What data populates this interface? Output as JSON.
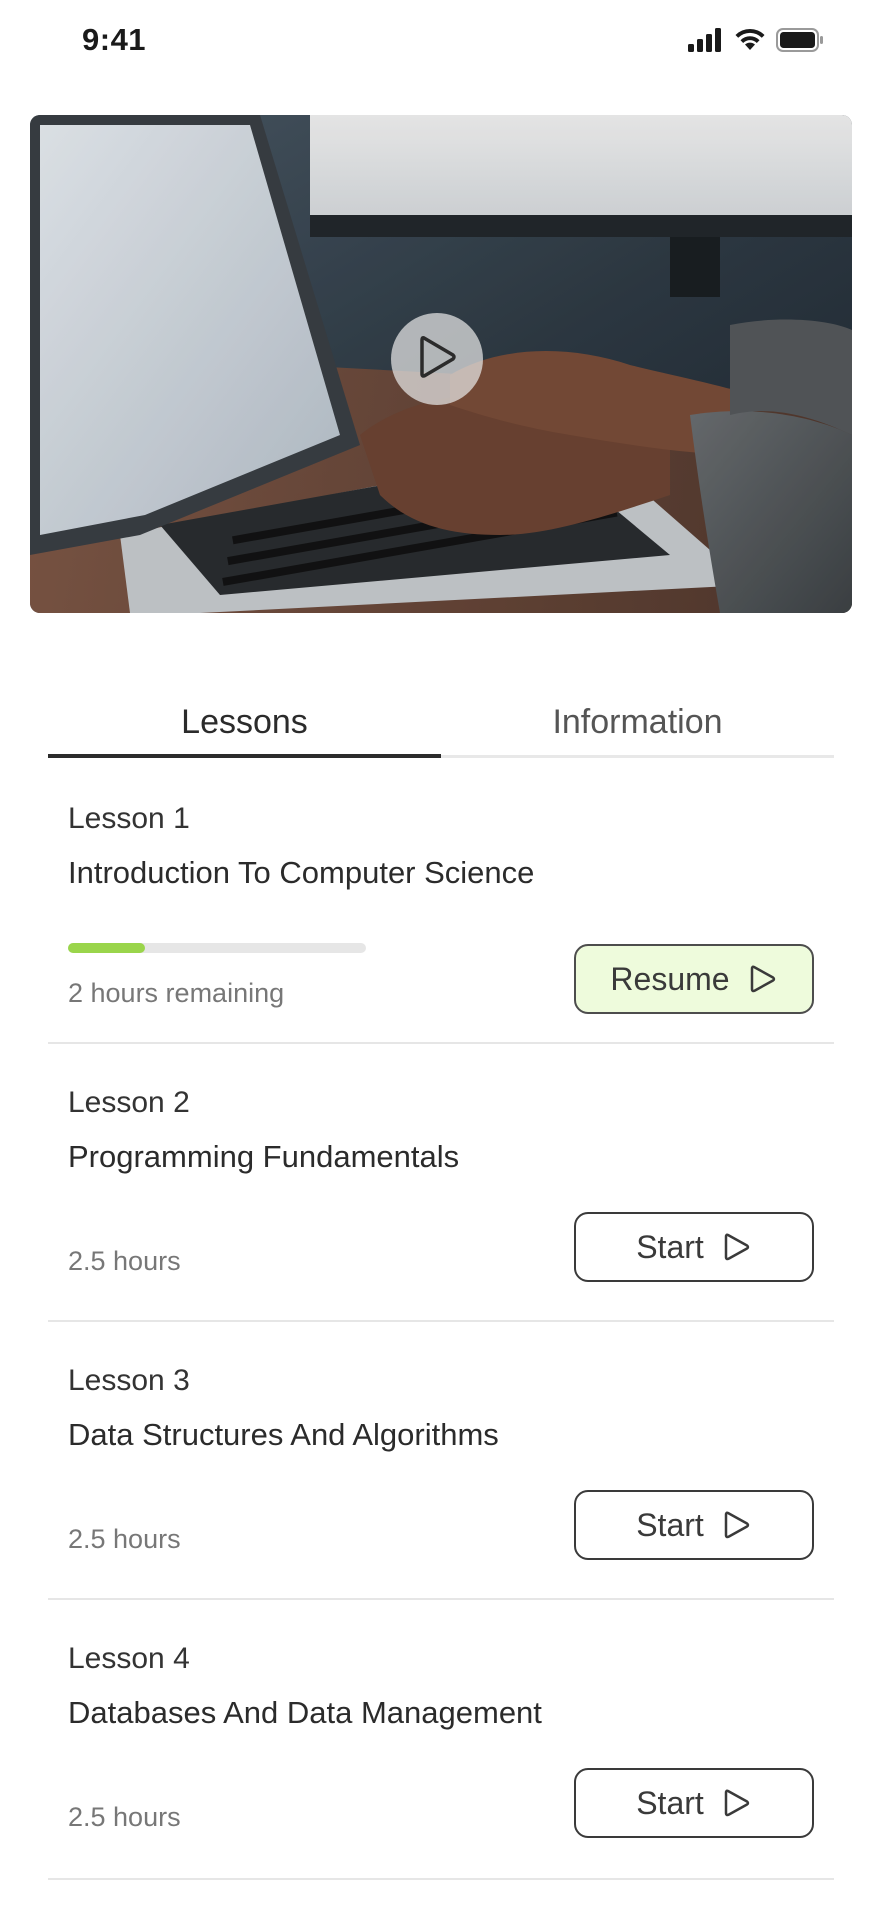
{
  "status_bar": {
    "time": "9:41",
    "icons": [
      "cellular-signal-icon",
      "wifi-icon",
      "battery-icon"
    ]
  },
  "video": {
    "play_icon": "play-icon"
  },
  "tabs": [
    {
      "label": "Lessons",
      "active": true
    },
    {
      "label": "Information",
      "active": false
    }
  ],
  "lessons": [
    {
      "number": "Lesson 1",
      "title": "Introduction To Computer Science",
      "meta": "2 hours remaining",
      "progress": 0.26,
      "button": "Resume"
    },
    {
      "number": "Lesson 2",
      "title": "Programming Fundamentals",
      "meta": "2.5 hours",
      "button": "Start"
    },
    {
      "number": "Lesson 3",
      "title": "Data Structures And Algorithms",
      "meta": "2.5 hours",
      "button": "Start"
    },
    {
      "number": "Lesson  4",
      "title": "Databases And Data Management",
      "meta": "2.5 hours",
      "button": "Start"
    }
  ],
  "colors": {
    "accent_progress": "#9ad54b",
    "resume_bg": "#eefbdc",
    "text": "#2b2b2b"
  }
}
